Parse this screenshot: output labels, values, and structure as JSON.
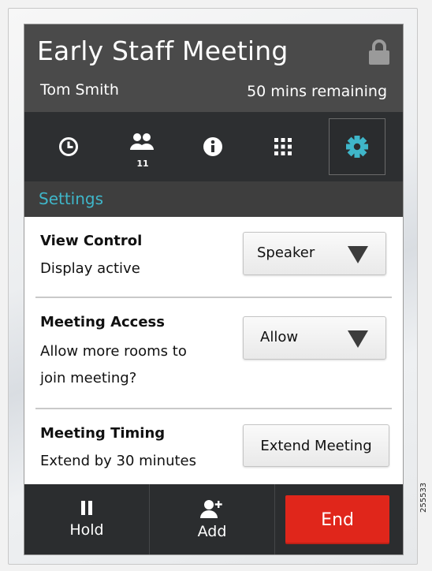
{
  "header": {
    "title": "Early Staff Meeting",
    "host": "Tom Smith",
    "remaining": "50 mins remaining"
  },
  "tabs": [
    {
      "name": "clock",
      "icon": "clock-icon"
    },
    {
      "name": "participants",
      "icon": "participants-icon",
      "badge": "11"
    },
    {
      "name": "info",
      "icon": "info-icon"
    },
    {
      "name": "keypad",
      "icon": "keypad-icon"
    },
    {
      "name": "settings",
      "icon": "gear-icon",
      "active": true
    }
  ],
  "section": {
    "title": "Settings"
  },
  "rows": {
    "view_control": {
      "title": "View Control",
      "desc": "Display active",
      "value": "Speaker"
    },
    "meeting_access": {
      "title": "Meeting Access",
      "desc_line1": "Allow more rooms to",
      "desc_line2": "join meeting?",
      "value": "Allow"
    },
    "meeting_timing": {
      "title": "Meeting Timing",
      "desc": "Extend by 30 minutes",
      "button": "Extend Meeting"
    }
  },
  "bottom": {
    "hold": "Hold",
    "add": "Add",
    "end": "End"
  },
  "figure_id": "255533",
  "colors": {
    "accent": "#3fb6c9",
    "end": "#e0261b",
    "header": "#4a4a4a",
    "bar": "#2d2f31"
  }
}
